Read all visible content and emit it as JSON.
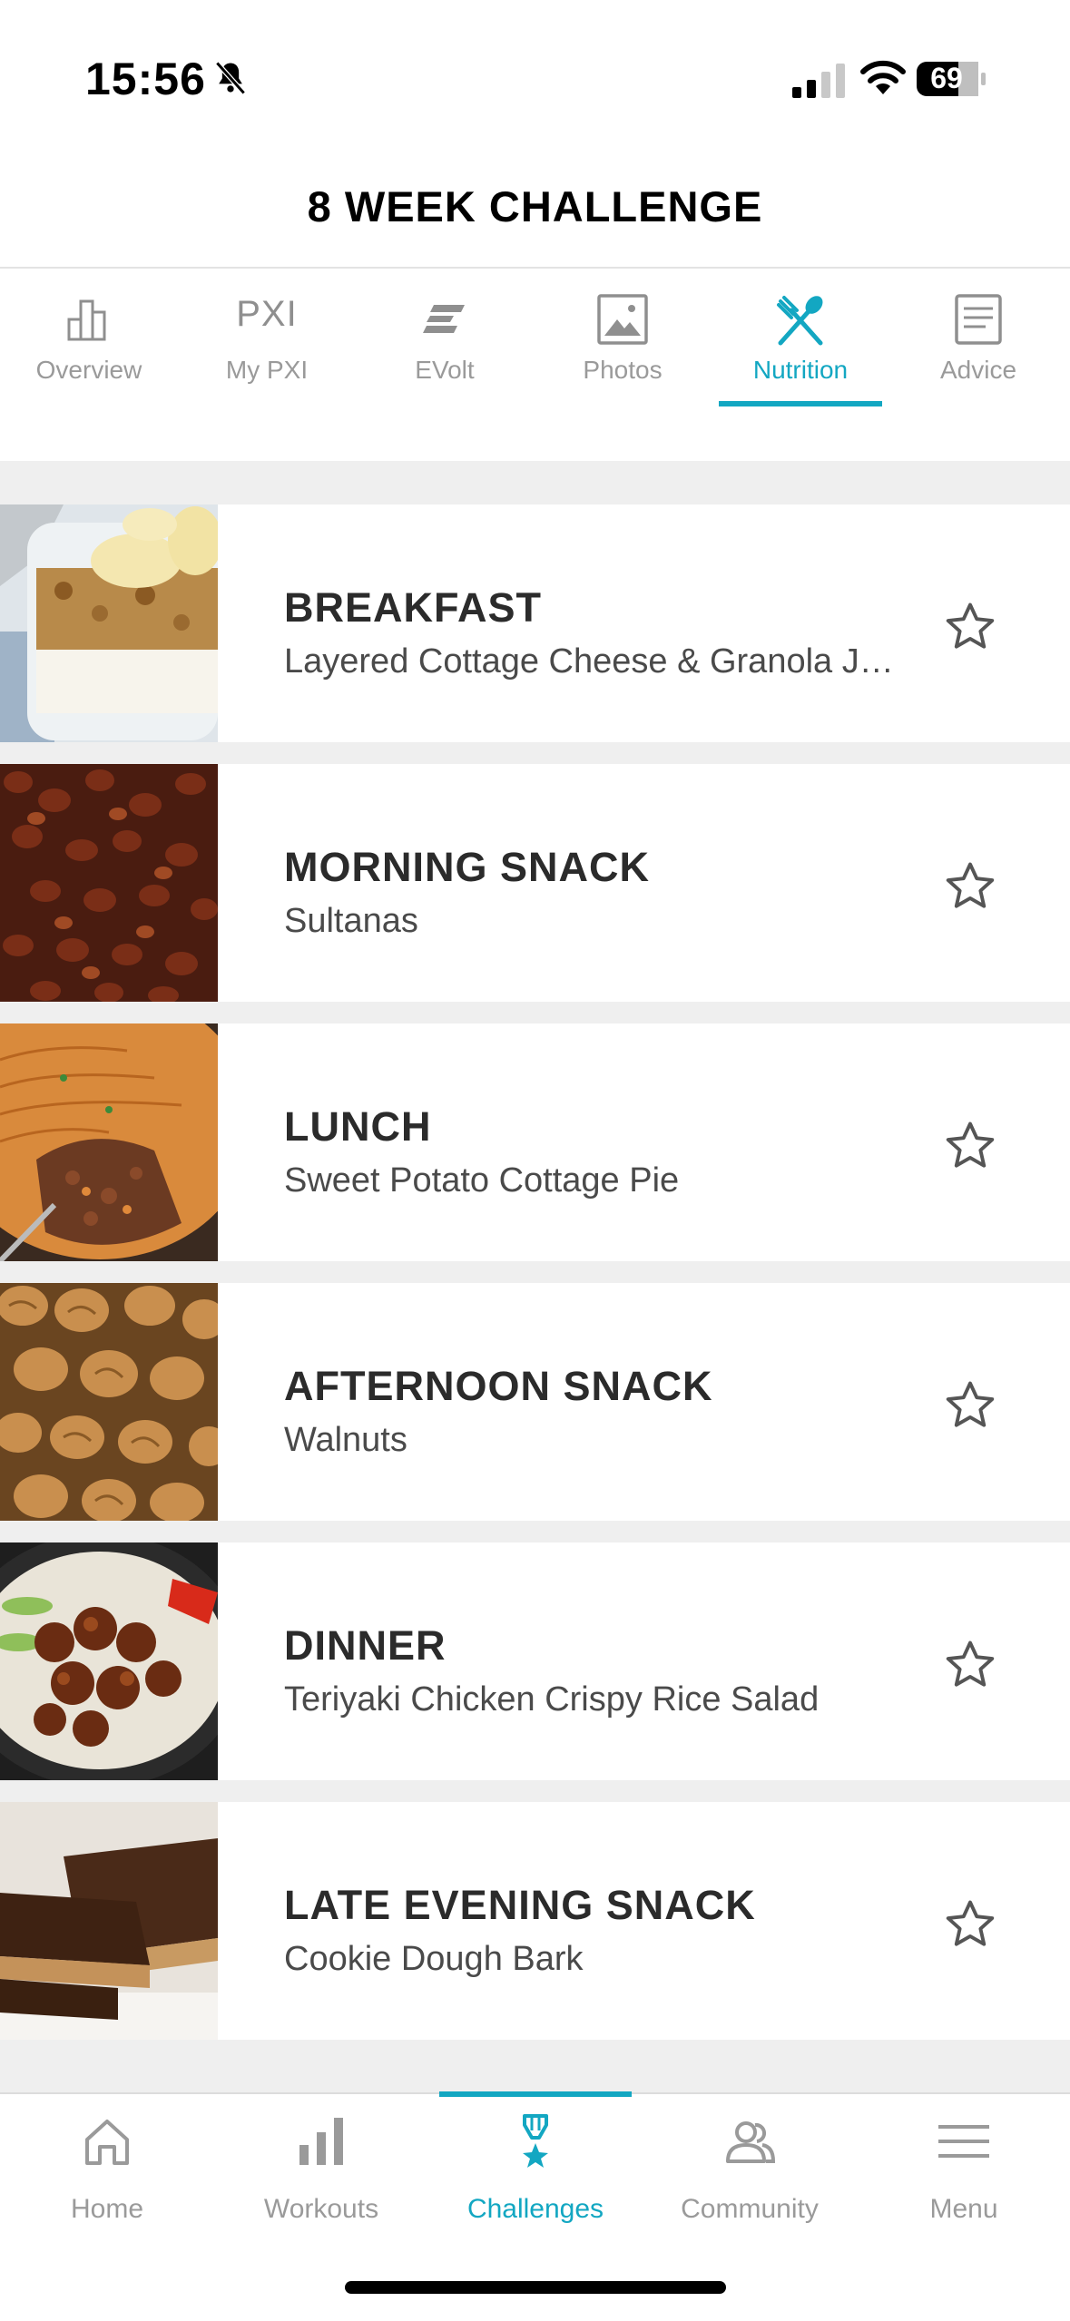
{
  "status_bar": {
    "time": "15:56",
    "battery": "69"
  },
  "header": {
    "title": "8 WEEK CHALLENGE"
  },
  "tabs": [
    {
      "label": "Overview",
      "icon": "bar-chart-icon"
    },
    {
      "label": "My PXI",
      "icon_text": "PXI"
    },
    {
      "label": "EVolt",
      "icon": "evolt-icon"
    },
    {
      "label": "Photos",
      "icon": "image-icon"
    },
    {
      "label": "Nutrition",
      "icon": "fork-spoon-icon",
      "active": true
    },
    {
      "label": "Advice",
      "icon": "document-icon"
    }
  ],
  "meals": [
    {
      "title": "BREAKFAST",
      "subtitle": "Layered Cottage Cheese & Granola Jars",
      "image": "granola-jar-photo"
    },
    {
      "title": "MORNING SNACK",
      "subtitle": "Sultanas",
      "image": "sultanas-photo"
    },
    {
      "title": "LUNCH",
      "subtitle": "Sweet Potato Cottage Pie",
      "image": "cottage-pie-photo"
    },
    {
      "title": "AFTERNOON SNACK",
      "subtitle": "Walnuts",
      "image": "walnuts-photo"
    },
    {
      "title": "DINNER",
      "subtitle": "Teriyaki Chicken Crispy Rice Salad",
      "image": "teriyaki-chicken-photo"
    },
    {
      "title": "LATE EVENING SNACK",
      "subtitle": "Cookie Dough Bark",
      "image": "cookie-dough-bark-photo"
    }
  ],
  "bottom_nav": [
    {
      "label": "Home",
      "icon": "home-icon"
    },
    {
      "label": "Workouts",
      "icon": "bars-icon"
    },
    {
      "label": "Challenges",
      "icon": "medal-icon",
      "active": true
    },
    {
      "label": "Community",
      "icon": "people-icon"
    },
    {
      "label": "Menu",
      "icon": "hamburger-icon"
    }
  ],
  "colors": {
    "accent": "#13a7c2",
    "inactive": "#9a9a9a",
    "list_bg": "#efefef"
  }
}
